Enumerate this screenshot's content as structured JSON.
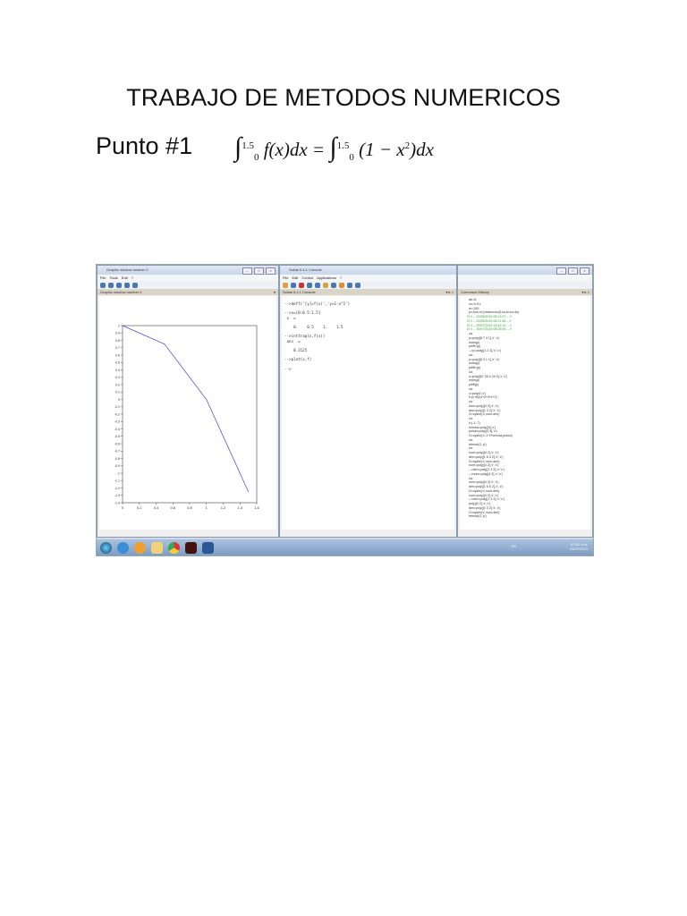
{
  "document": {
    "title": "TRABAJO DE METODOS NUMERICOS",
    "section": "Punto #1",
    "formula": {
      "upper": "1.5",
      "lower": "0",
      "lhs": "f(x)dx =",
      "rhs": "(1 − x",
      "exp": "2",
      "rhs_end": ")dx"
    }
  },
  "graphic_window": {
    "title": "Graphic window number 0",
    "menu": [
      "File",
      "Tools",
      "Edit",
      "?"
    ],
    "dock_label": "Graphic window number 0"
  },
  "console_window": {
    "title": "Scilab 5.4.1 Console",
    "menu": [
      "File",
      "Edit",
      "Control",
      "Applications",
      "?"
    ],
    "dock_label": "Scilab 5.4.1 Console",
    "lines": [
      "-->deff('[y]=f(x)','y=1-x^2')",
      "",
      "-->x=[0:0.5:1.5]",
      " x  =",
      "",
      "    0.    0.5    1.    1.5",
      "",
      "-->inttrap(x,f(x))",
      " ans  =",
      "",
      "    0.3125",
      "",
      "-->plot(x,f)",
      "",
      "-->"
    ]
  },
  "history_window": {
    "dock_label": "Command History",
    "lines": [
      {
        "t": "ab=5;"
      },
      {
        "t": "nn=0.01;"
      },
      {
        "t": "m=100;"
      },
      {
        "t": "[xi,fi,bn,er]=biseccion(f,xa,xb,nx,dx)"
      },
      {
        "t": "// -- 22/05/2019 05:21:07 -- //",
        "g": true
      },
      {
        "t": "// -- 22/05/2019 08:11:46 -- //",
        "g": true
      },
      {
        "t": "// -- 29/07/2019 14:42:14 -- //",
        "g": true
      },
      {
        "t": "// -- 30/07/2019 08:25:05 -- //",
        "g": true
      },
      {
        "t": "clc"
      },
      {
        "t": "p=poly([8 7 4 1],'x','c')"
      },
      {
        "t": "roots(p)"
      },
      {
        "t": "pdiff=(p)"
      },
      {
        "t": "-->p=poly([1 2 3],'x','c')"
      },
      {
        "t": "clc"
      },
      {
        "t": "p=poly([8 3 1 1],'x','c')"
      },
      {
        "t": "roots(p)"
      },
      {
        "t": "pdiff=(p)"
      },
      {
        "t": "clc"
      },
      {
        "t": "c=poly([67 28 4 24 0],'x','c')"
      },
      {
        "t": "roots(p)"
      },
      {
        "t": "pdiff(p)"
      },
      {
        "t": "clc"
      },
      {
        "t": "x=poly(0,'x')"
      },
      {
        "t": "f=(x+6)/(x^3+3*x+2)"
      },
      {
        "t": "clc"
      },
      {
        "t": "num=poly([4 2],'x','c')"
      },
      {
        "t": "den=poly([1 3 2],'x','c')"
      },
      {
        "t": "G=syslin('c',num,den)"
      },
      {
        "t": "clc"
      },
      {
        "t": "t=(-1:.7)"
      },
      {
        "t": "cerosa=poly([3],'x')"
      },
      {
        "t": "polosi=poly([4 3],'x')"
      },
      {
        "t": "G=syslin('c',1^2*cerosa,polosi)"
      },
      {
        "t": "clc"
      },
      {
        "t": "trfmod(G,'p')"
      },
      {
        "t": "clc"
      },
      {
        "t": "num=poly([4 2],'x','c')"
      },
      {
        "t": "den=poly([1 6 3 2],'x','c')"
      },
      {
        "t": "G=syslin('c',num,den)"
      },
      {
        "t": "num=poly([4 2],'x','c')"
      },
      {
        "t": "-->den=poly([1 3 2],'x','c')"
      },
      {
        "t": "-->num=poly([4 2],'x','c')"
      },
      {
        "t": "clc"
      },
      {
        "t": "num=poly([4 2],'x','c')"
      },
      {
        "t": "den=poly([1 6 6 2],'x','c')"
      },
      {
        "t": "G=syslin('c',num,den)"
      },
      {
        "t": "num=poly([4 2],'x','c')"
      },
      {
        "t": "-->den=poly([1 3 2],'x','c')"
      },
      {
        "t": "poly([4 2],'x','c')"
      },
      {
        "t": "den=poly([1 3 2],'x','c')"
      },
      {
        "t": "G=syslin('c',num,den)"
      },
      {
        "t": "trfmod(G,'p')"
      }
    ]
  },
  "taskbar": {
    "lang": "ES",
    "time": "07:51 a.m.",
    "date": "31/07/2019"
  },
  "chart_data": {
    "type": "line",
    "x": [
      0,
      0.5,
      1,
      1.5
    ],
    "series": [
      {
        "name": "f",
        "values": [
          1,
          0.75,
          0,
          -1.25
        ],
        "color": "#4040e0"
      }
    ],
    "xlim": [
      0,
      1.6
    ],
    "ylim": [
      -1.4,
      1
    ],
    "xticks": [
      "0",
      "0.2",
      "0.4",
      "0.6",
      "0.8",
      "1",
      "1.2",
      "1.4",
      "1.6"
    ],
    "yticks": [
      "1",
      "0.9",
      "0.8",
      "0.7",
      "0.6",
      "0.5",
      "0.4",
      "0.3",
      "0.2",
      "0.1",
      "0",
      "-0.1",
      "-0.2",
      "-0.3",
      "-0.4",
      "-0.5",
      "-0.6",
      "-0.7",
      "-0.8",
      "-0.9",
      "-1",
      "-1.1",
      "-1.2",
      "-1.3",
      "-1.4"
    ],
    "title": "",
    "xlabel": "",
    "ylabel": "",
    "grid": false
  }
}
